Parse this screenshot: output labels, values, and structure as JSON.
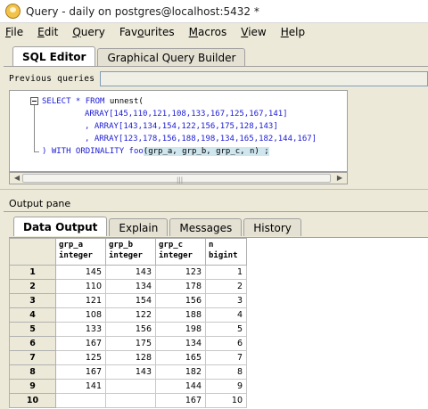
{
  "window": {
    "title": "Query - daily on postgres@localhost:5432 *"
  },
  "menu": [
    {
      "label": "File",
      "ul": "F",
      "rest": "ile"
    },
    {
      "label": "Edit",
      "ul": "E",
      "rest": "dit"
    },
    {
      "label": "Query",
      "ul": "Q",
      "rest": "uery"
    },
    {
      "label": "Favourites",
      "pre": "Fav",
      "ul": "o",
      "rest": "urites"
    },
    {
      "label": "Macros",
      "ul": "M",
      "rest": "acros"
    },
    {
      "label": "View",
      "ul": "V",
      "rest": "iew"
    },
    {
      "label": "Help",
      "ul": "H",
      "rest": "elp"
    }
  ],
  "editor_tabs": [
    "SQL Editor",
    "Graphical Query Builder"
  ],
  "previous_queries": {
    "label": "Previous queries",
    "value": ""
  },
  "code": {
    "line1_kw": "SELECT * FROM",
    "line1_rest": " unnest(",
    "line2": "ARRAY[145,110,121,108,133,167,125,167,141]",
    "line3": ", ARRAY[143,134,154,122,156,175,128,143]",
    "line4": ", ARRAY[123,178,156,188,198,134,165,182,144,167]",
    "line5_pre": ") WITH ORDINALITY foo",
    "line5_mid": "(grp_a, grp_b, grp_c, n",
    "line5_post": ") ;"
  },
  "output": {
    "label": "Output pane",
    "tabs": [
      "Data Output",
      "Explain",
      "Messages",
      "History"
    ]
  },
  "grid": {
    "columns": [
      {
        "name": "grp_a",
        "type": "integer"
      },
      {
        "name": "grp_b",
        "type": "integer"
      },
      {
        "name": "grp_c",
        "type": "integer"
      },
      {
        "name": "n",
        "type": "bigint"
      }
    ],
    "rows": [
      [
        "145",
        "143",
        "123",
        "1"
      ],
      [
        "110",
        "134",
        "178",
        "2"
      ],
      [
        "121",
        "154",
        "156",
        "3"
      ],
      [
        "108",
        "122",
        "188",
        "4"
      ],
      [
        "133",
        "156",
        "198",
        "5"
      ],
      [
        "167",
        "175",
        "134",
        "6"
      ],
      [
        "125",
        "128",
        "165",
        "7"
      ],
      [
        "167",
        "143",
        "182",
        "8"
      ],
      [
        "141",
        "",
        "144",
        "9"
      ],
      [
        "",
        "",
        "167",
        "10"
      ]
    ]
  }
}
